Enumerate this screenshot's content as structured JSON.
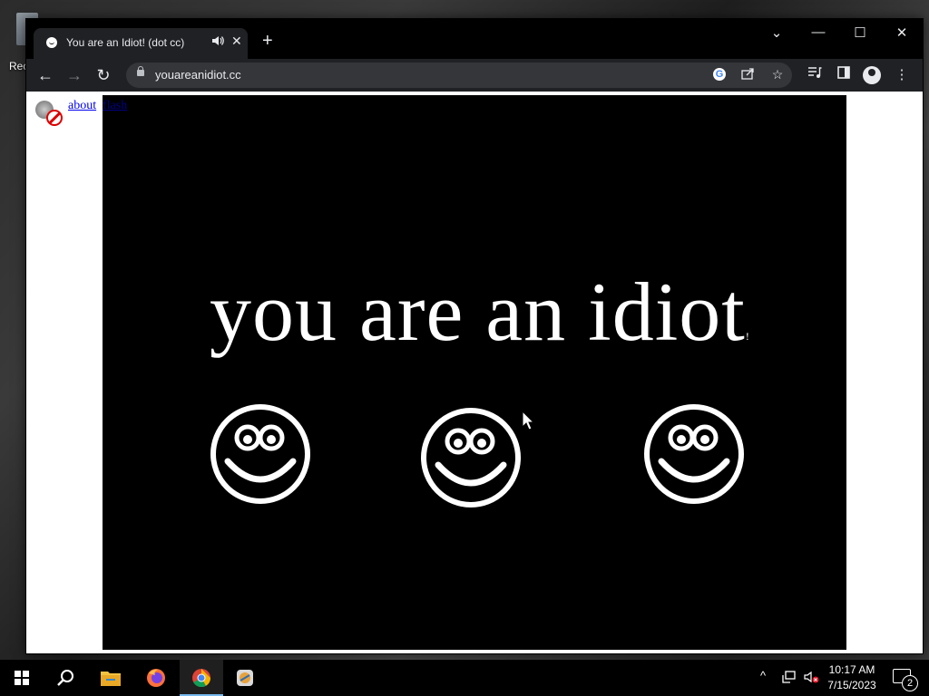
{
  "desktop": {
    "icon_label": "Rec"
  },
  "browser": {
    "tab": {
      "title": "You are an Idiot! (dot cc)",
      "audio_icon": "speaker-icon",
      "close": "✕"
    },
    "new_tab": "+",
    "window_controls": {
      "dropdown": "⌄",
      "minimize": "—",
      "maximize": "☐",
      "close": "✕"
    },
    "nav": {
      "back": "←",
      "forward": "→",
      "reload": "↻"
    },
    "url": "youareanidiot.cc",
    "omnibox_icons": [
      "google-lens-icon",
      "share-icon",
      "star-icon"
    ],
    "toolbar_icons": [
      "media-control-icon",
      "side-panel-icon",
      "profile-icon",
      "menu-icon"
    ],
    "menu": "⋮"
  },
  "page": {
    "links": {
      "about": "about",
      "flash": "flash"
    },
    "headline": "you are an idiot",
    "headline_suffix": "!"
  },
  "taskbar": {
    "apps": [
      "windows-start-icon",
      "search-icon",
      "file-explorer-icon",
      "firefox-icon",
      "chrome-icon",
      "app-icon"
    ],
    "tray_chevron": "^",
    "time": "10:17 AM",
    "date": "7/15/2023",
    "notification_count": "2"
  }
}
